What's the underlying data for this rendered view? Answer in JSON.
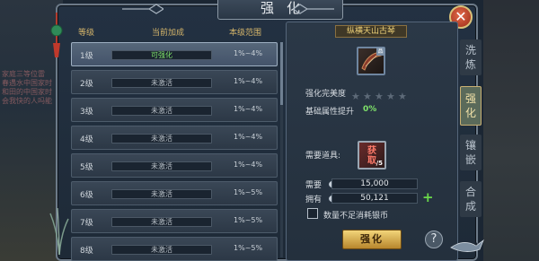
{
  "title": "强化",
  "close_label": "✕",
  "list": {
    "headers": {
      "level": "等级",
      "bonus": "当前加成",
      "range": "本级范围"
    },
    "rows": [
      {
        "level": "1级",
        "status": "可强化",
        "range": "1%~4%",
        "active": true
      },
      {
        "level": "2级",
        "status": "未激活",
        "range": "1%~4%",
        "active": false
      },
      {
        "level": "3级",
        "status": "未激活",
        "range": "1%~4%",
        "active": false
      },
      {
        "level": "4级",
        "status": "未激活",
        "range": "1%~4%",
        "active": false
      },
      {
        "level": "5级",
        "status": "未激活",
        "range": "1%~4%",
        "active": false
      },
      {
        "level": "6级",
        "status": "未激活",
        "range": "1%~5%",
        "active": false
      },
      {
        "level": "7级",
        "status": "未激活",
        "range": "1%~5%",
        "active": false
      },
      {
        "level": "8级",
        "status": "未激活",
        "range": "1%~5%",
        "active": false
      }
    ]
  },
  "detail": {
    "item_name": "纵横天山古琴",
    "item_badge": "品",
    "perfection_label": "强化完美度",
    "stars_total": 5,
    "stars_filled": 0,
    "attr_label": "基础属性提升",
    "attr_value": "0%",
    "required_label": "需要道具:",
    "required_item_text": "获\n取",
    "required_item_qty": "/5",
    "need_label": "需要",
    "need_value": "15,000",
    "own_label": "拥有",
    "own_value": "50,121",
    "checkbox_label": "数量不足消耗银币",
    "strengthen_label": "强化",
    "help_label": "?"
  },
  "tabs": [
    {
      "label": "洗炼",
      "active": false
    },
    {
      "label": "强化",
      "active": true
    },
    {
      "label": "镶嵌",
      "active": false
    },
    {
      "label": "合成",
      "active": false
    }
  ],
  "background_text": "家庭三等位雷\n春遇水中国家时\n和田的中国家时\n会我快的人吗能",
  "colors": {
    "accent_gold": "#f0d37a",
    "active_green": "#7fe36a",
    "close_red": "#c2452a"
  }
}
